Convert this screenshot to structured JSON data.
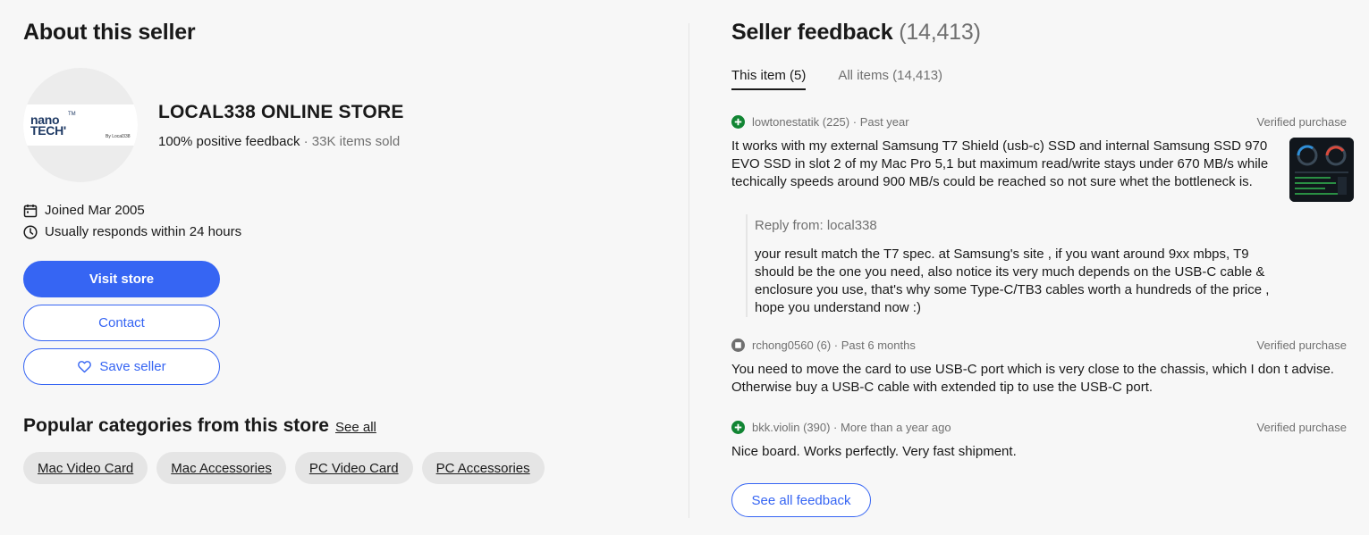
{
  "about": {
    "title": "About this seller",
    "store_name": "LOCAL338 ONLINE STORE",
    "positive_feedback": "100% positive feedback",
    "separator": "·",
    "items_sold": "33K items sold",
    "logo": {
      "line1": "nano",
      "line2": "TECH'",
      "tm": "TM",
      "by": "By Local338"
    },
    "joined": "Joined Mar 2005",
    "responds": "Usually responds within 24 hours",
    "buttons": {
      "visit": "Visit store",
      "contact": "Contact",
      "save": "Save seller"
    },
    "popular": {
      "title": "Popular categories from this store",
      "see_all": "See all",
      "categories": [
        "Mac Video Card",
        "Mac Accessories",
        "PC Video Card",
        "PC Accessories"
      ]
    }
  },
  "feedback": {
    "title": "Seller feedback",
    "count": "(14,413)",
    "tabs": [
      {
        "label": "This item (5)",
        "active": true
      },
      {
        "label": "All items (14,413)",
        "active": false
      }
    ],
    "entries": [
      {
        "rating": "positive",
        "user": "lowtonestatik (225)",
        "time": "Past year",
        "verified": "Verified purchase",
        "text_lines": [
          "It works with my external Samsung T7 Shield (usb-c) SSD and internal Samsung SSD 970",
          "EVO SSD in slot 2 of my Mac Pro 5,1 but maximum read/write stays under 670 MB/s while",
          "techically speeds around 900 MB/s could be reached so not sure whet the bottleneck is."
        ],
        "reply": {
          "from": "Reply from: local338",
          "lines": [
            "your result match the T7 spec. at Samsung's site , if you want around 9xx mbps, T9",
            "should be the one you need, also notice its very much depends on the USB-C cable &",
            "enclosure you use, that's why some Type-C/TB3 cables worth a hundreds of the price ,",
            "hope you understand now :)"
          ]
        }
      },
      {
        "rating": "neutral",
        "user": "rchong0560 (6)",
        "time": "Past 6 months",
        "verified": "Verified purchase",
        "text_lines": [
          "You need to move the card to use USB-C port which is very close to the chassis, which I don t advise.",
          "Otherwise buy a USB-C cable with extended tip to use the USB-C port."
        ]
      },
      {
        "rating": "positive",
        "user": "bkk.violin (390)",
        "time": "More than a year ago",
        "verified": "Verified purchase",
        "text_lines": [
          "Nice board. Works perfectly. Very fast shipment."
        ]
      }
    ],
    "see_all_button": "See all feedback",
    "colors": {
      "positive": "#118533",
      "neutral": "#707070",
      "accent": "#3665f3"
    }
  }
}
